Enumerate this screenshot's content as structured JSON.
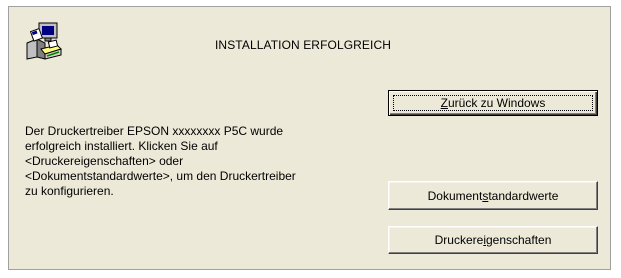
{
  "dialog": {
    "title": "INSTALLATION ERFOLGREICH",
    "icon": "printer-setup-icon",
    "message": "Der Druckertreiber EPSON xxxxxxxx P5C wurde\nerfolgreich installiert. Klicken Sie auf\n<Druckereigenschaften> oder\n<Dokumentstandardwerte>, um den Druckertreiber\nzu konfigurieren."
  },
  "buttons": {
    "back": {
      "before": "",
      "mnemonic": "Z",
      "after": "urück zu Windows"
    },
    "doc_defaults": {
      "before": "Dokument",
      "mnemonic": "s",
      "after": "tandardwerte"
    },
    "printer_props": {
      "before": "Druckere",
      "mnemonic": "i",
      "after": "genschaften"
    }
  },
  "colors": {
    "dialog_background": "#ece9d8",
    "text": "#000000"
  }
}
